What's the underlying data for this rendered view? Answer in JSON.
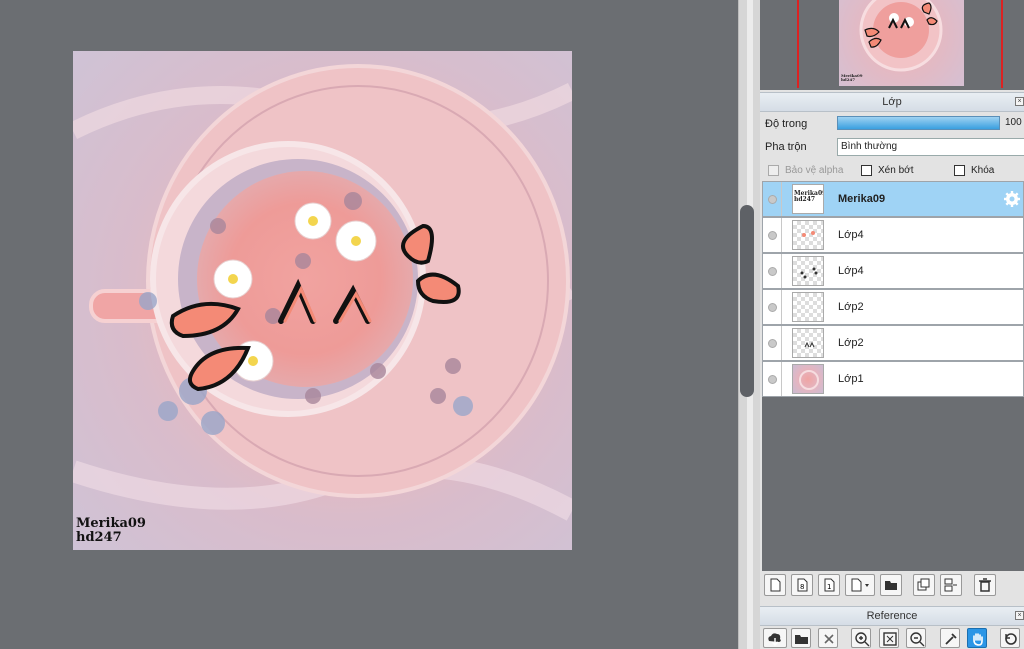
{
  "artwork": {
    "watermark_line1": "Merika09",
    "watermark_line2": "hd247"
  },
  "navigator": {
    "thumb_text": "Merika09\nhd247"
  },
  "layer_panel": {
    "title": "Lớp",
    "opacity_label": "Độ trong",
    "opacity_value": "100",
    "blend_label": "Pha trộn",
    "blend_value": "Bình thường",
    "protect_alpha_label": "Bảo vệ alpha",
    "clip_label": "Xén bớt",
    "lock_label": "Khóa",
    "layers": [
      {
        "name": "Merika09",
        "thumb_text": "Merika09\nhd247",
        "selected": true
      },
      {
        "name": "Lớp4"
      },
      {
        "name": "Lớp4"
      },
      {
        "name": "Lớp2"
      },
      {
        "name": "Lớp2"
      },
      {
        "name": "Lớp1"
      }
    ]
  },
  "reference_panel": {
    "title": "Reference"
  },
  "colors": {
    "selected_layer": "#9fd3f5",
    "opacity_bar": "#3aa0e0",
    "active_tool": "#2c96e6",
    "frame_red": "#dd2222"
  },
  "icons": [
    "new-layer-icon",
    "new-raster-icon",
    "new-1bit-icon",
    "add-layer-icon",
    "folder-icon",
    "duplicate-icon",
    "merge-icon",
    "trash-icon",
    "cloud-download-icon",
    "open-folder-icon",
    "close-icon",
    "zoom-in-icon",
    "fit-icon",
    "zoom-out-icon",
    "eyedropper-icon",
    "hand-icon",
    "rotate-icon",
    "gear-icon"
  ]
}
